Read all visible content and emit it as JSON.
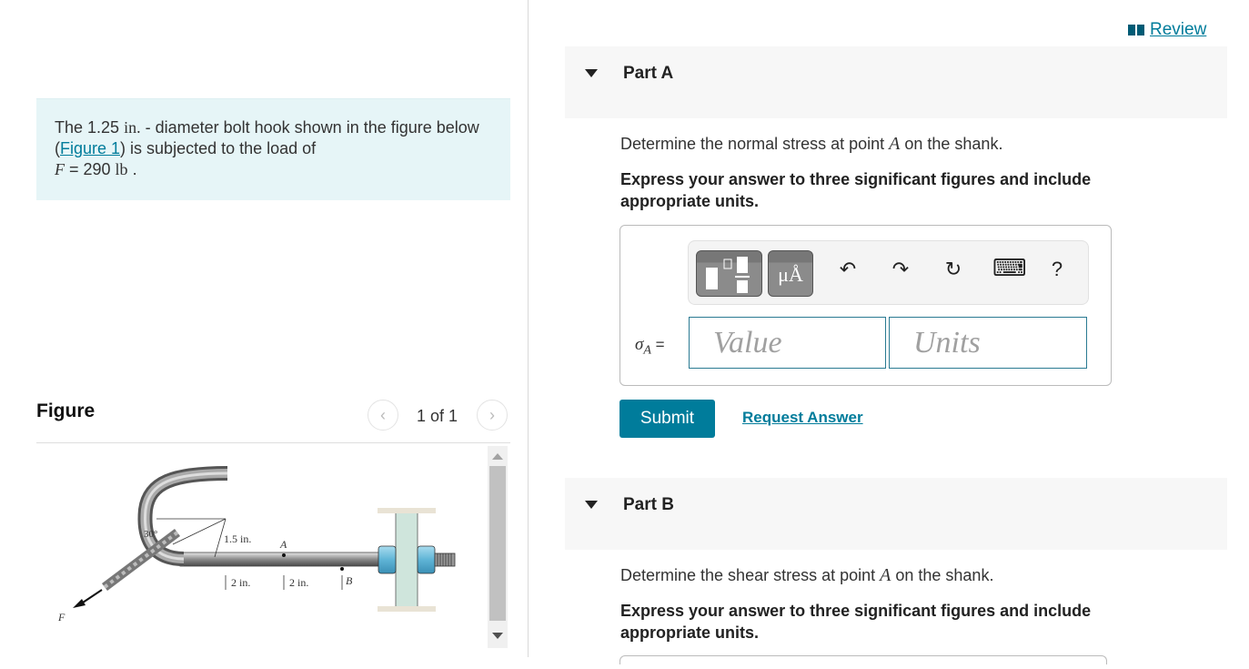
{
  "review": {
    "label": "Review",
    "icon": "book-icon"
  },
  "problem": {
    "text_before": "The 1.25 ",
    "unit_in": "in.",
    "text_mid": " - diameter bolt hook shown in the figure below (",
    "figure_link": "Figure 1",
    "text_after": ") is subjected to the load of",
    "force_symbol": "F",
    "force_value": " = 290 ",
    "force_unit": "lb",
    "period": " ."
  },
  "figure": {
    "title": "Figure",
    "counter": "1 of 1",
    "prev_icon": "chevron-left-icon",
    "next_icon": "chevron-right-icon",
    "labels": {
      "angle": "30°",
      "radius": "1.5 in.",
      "point_a": "A",
      "point_b": "B",
      "dim1": "2 in.",
      "dim2": "2 in.",
      "force": "F"
    }
  },
  "part_a": {
    "title": "Part A",
    "prompt_before": "Determine the normal stress at point ",
    "prompt_point": "A",
    "prompt_after": " on the shank.",
    "instruction": "Express your answer to three significant figures and include appropriate units.",
    "answer_label_symbol": "σ",
    "answer_label_sub": "A",
    "answer_label_eq": " =",
    "value_placeholder": "Value",
    "units_placeholder": "Units",
    "toolbar": {
      "units_label": "μÅ",
      "undo": "↶",
      "redo": "↷",
      "reset": "↻",
      "keyboard": "⌨",
      "help": "?"
    },
    "submit_label": "Submit",
    "request_answer_label": "Request Answer"
  },
  "part_b": {
    "title": "Part B",
    "prompt_before": "Determine the shear stress at point ",
    "prompt_point": "A",
    "prompt_after": " on the shank.",
    "instruction": "Express your answer to three significant figures and include appropriate units."
  }
}
